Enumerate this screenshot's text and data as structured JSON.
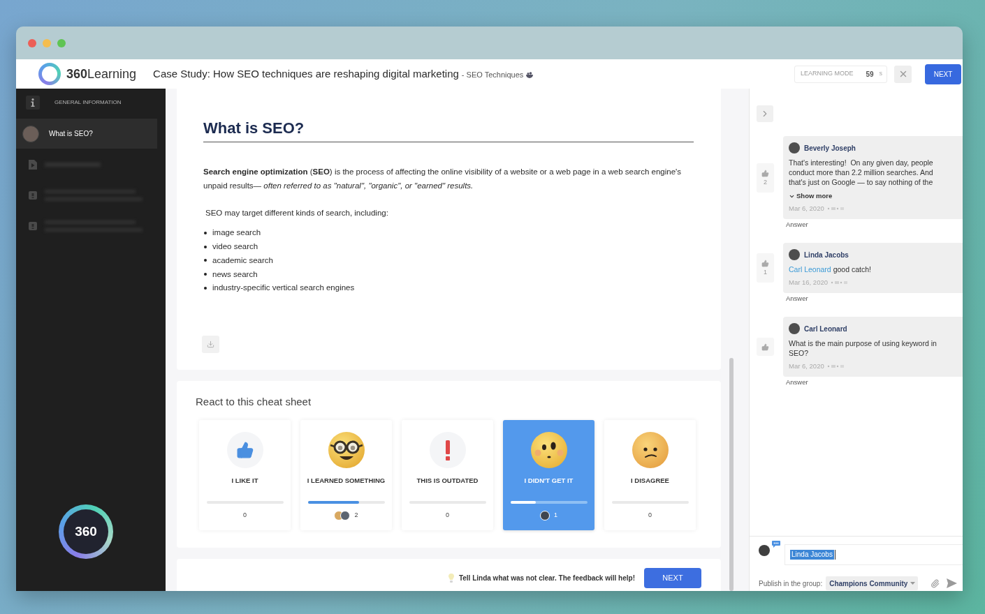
{
  "header": {
    "logo_text": "**360**Learning",
    "title": "Case Study: How SEO techniques are reshaping digital marketing",
    "subtitle": "- SEO Techniques",
    "learning_mode": {
      "label": "LEARNING MODE",
      "value": "59",
      "unit": "s"
    },
    "next_button": "NEXT"
  },
  "sidebar": {
    "section": "GENERAL INFORMATION",
    "items": [
      {
        "kind": "lesson",
        "label": "What is SEO?",
        "selected": true
      },
      {
        "kind": "document",
        "selected": false
      },
      {
        "kind": "quiz",
        "selected": false
      },
      {
        "kind": "quiz",
        "selected": false
      }
    ],
    "badge": "360"
  },
  "article": {
    "heading": "What is SEO?",
    "paragraph": "**Search engine optimization** (**SEO**) is the process of affecting the online visibility of a website or a web page in a web search engine's unpaid results— *often referred to as \"natural\", \"organic\", or \"earned\" results.*",
    "intro": "SEO may target different kinds of search, including:",
    "list": [
      "image search",
      "video search",
      "academic search",
      "news search",
      "industry-specific vertical search engines"
    ]
  },
  "reactions": {
    "title": "React to this cheat sheet",
    "items": [
      {
        "kind": "like",
        "label": "I LIKE IT",
        "selected": false,
        "count": "0"
      },
      {
        "kind": "learned",
        "label": "I LEARNED SOMETHING",
        "selected": false,
        "level": 0.67,
        "avatars": [
          {
            "color": "#d8a860"
          },
          {
            "color": "#5b6470"
          }
        ],
        "count": "2"
      },
      {
        "kind": "outdated",
        "label": "THIS IS OUTDATED",
        "selected": false,
        "count": "0"
      },
      {
        "kind": "confused",
        "label": "I DIDN'T GET IT",
        "selected": true,
        "level": 0.33,
        "avatars": [
          {
            "color": "#3f4650"
          }
        ],
        "count": "1"
      },
      {
        "kind": "disagree",
        "label": "I DISAGREE",
        "selected": false,
        "count": "0"
      }
    ]
  },
  "feedback": {
    "hint": "Tell Linda what was not clear. The feedback will help!",
    "button": "NEXT"
  },
  "comments": [
    {
      "author": "Beverly Joseph",
      "likes": "2",
      "text": "That's interesting!  On any given day, people conduct more than 2.2 million searches. And that's just on Google — to say nothing of the",
      "show_more": "Show more",
      "date": "Mar 6, 2020",
      "answer": "Answer"
    },
    {
      "author": "Linda Jacobs",
      "likes": "1",
      "mention": "Carl Leonard",
      "text": "good catch!",
      "date": "Mar 16, 2020",
      "answer": "Answer"
    },
    {
      "author": "Carl Leonard",
      "text": "What is the main purpose of using keyword in SEO?",
      "date": "Mar 6, 2020",
      "answer": "Answer"
    }
  ],
  "composer": {
    "value": "Linda Jacobs",
    "publish_label": "Publish in the group:",
    "group": "Champions Community"
  }
}
